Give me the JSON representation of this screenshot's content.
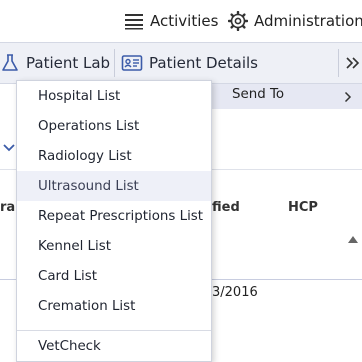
{
  "header": {
    "activities_label": "Activities",
    "activities_icon": "list-icon",
    "administration_label": "Administration",
    "administration_icon": "gear-icon"
  },
  "tabs": [
    {
      "label": "Patient Lab",
      "icon": "flask-icon"
    },
    {
      "label": "Patient Details",
      "icon": "id-card-icon"
    }
  ],
  "overflow_icon": "double-chevron-right-icon",
  "submenu": {
    "label": "Send To",
    "icon": "chevron-right-icon"
  },
  "background": {
    "col_partial_left": "ra",
    "col_modified_partial": "fied",
    "col_hcp": "HCP",
    "date_partial": "3/2016"
  },
  "dropdown": {
    "items": [
      {
        "label": "Hospital List"
      },
      {
        "label": "Operations List"
      },
      {
        "label": "Radiology List"
      },
      {
        "label": "Ultrasound List",
        "highlighted": true
      },
      {
        "label": "Repeat Prescriptions List"
      },
      {
        "label": "Kennel List"
      },
      {
        "label": "Card List"
      },
      {
        "label": "Cremation List"
      }
    ],
    "footer_item": {
      "label": "VetCheck"
    }
  },
  "colors": {
    "accent": "#3b5ba9",
    "tab_bar_bg": "#eef0f6",
    "highlight": "#eef0f8"
  }
}
